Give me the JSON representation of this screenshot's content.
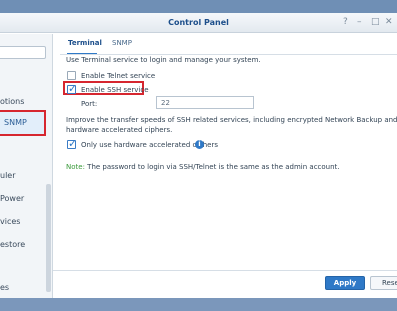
{
  "window": {
    "title": "Control Panel"
  },
  "sidebar": {
    "items": [
      {
        "label": "otions"
      },
      {
        "label": "SNMP"
      },
      {
        "label": "uler"
      },
      {
        "label": "Power"
      },
      {
        "label": "vices"
      },
      {
        "label": "estore"
      },
      {
        "label": "es"
      }
    ]
  },
  "tabs": [
    {
      "label": "Terminal"
    },
    {
      "label": "SNMP"
    }
  ],
  "terminal": {
    "intro": "Use Terminal service to login and manage your system.",
    "telnet_label": "Enable Telnet service",
    "telnet_checked": false,
    "ssh_label": "Enable SSH service",
    "ssh_checked": true,
    "port_label": "Port:",
    "port_value": "22",
    "improve_line1": "Improve the transfer speeds of SSH related services, including encrypted Network Backup and SFTP services, by u",
    "improve_line2": "hardware accelerated ciphers.",
    "hw_label": "Only use hardware accelerated ciphers",
    "hw_checked": true,
    "info_icon": "i",
    "note_label": "Note:",
    "note_text": "The password to login via SSH/Telnet is the same as the admin account."
  },
  "footer": {
    "apply_label": "Apply",
    "reset_label": "Rese"
  },
  "colors": {
    "accent": "#2f79c7",
    "highlight": "#d6262f",
    "title": "#1d4f8b"
  }
}
